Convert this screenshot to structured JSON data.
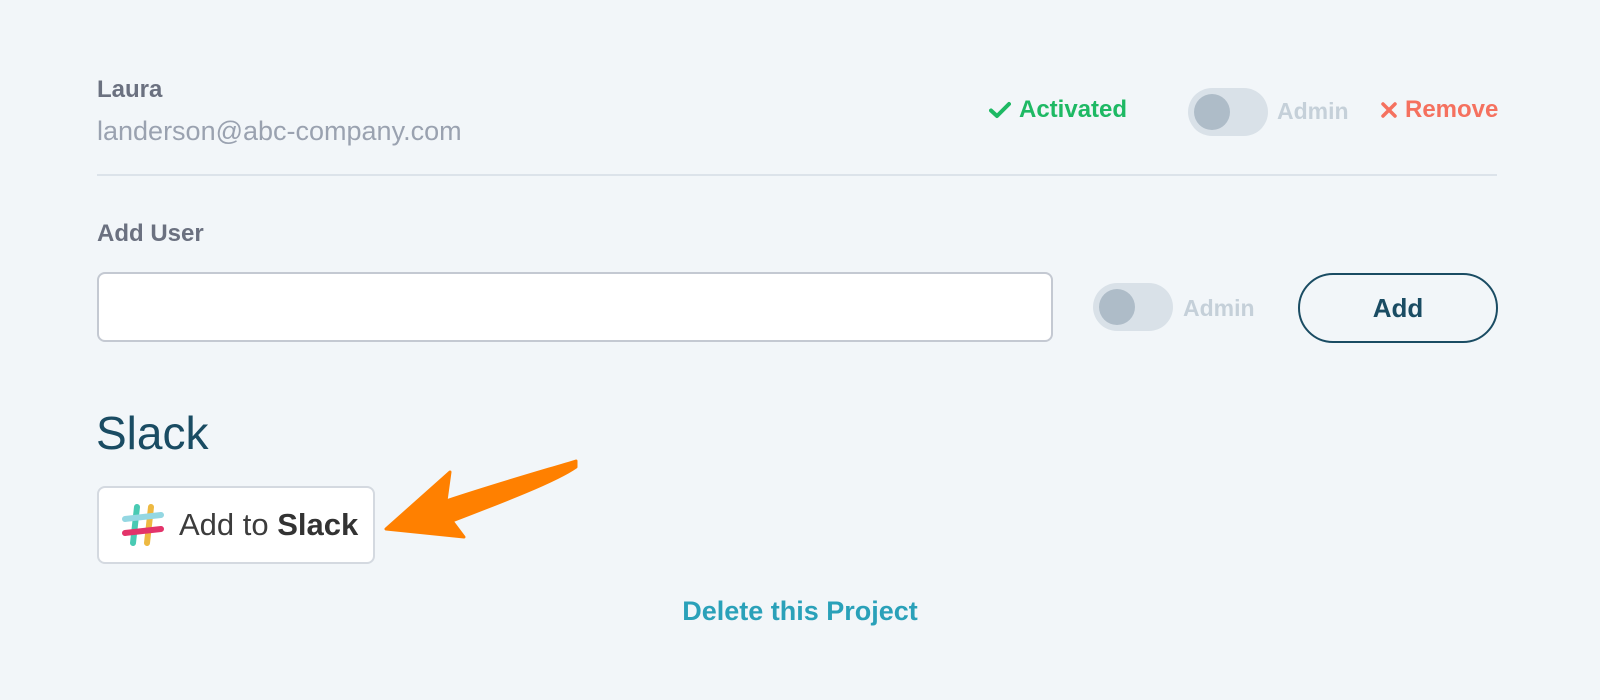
{
  "user": {
    "name": "Laura",
    "email": "landerson@abc-company.com",
    "status_label": "Activated",
    "admin_label": "Admin",
    "remove_label": "Remove"
  },
  "add_user": {
    "heading": "Add User",
    "input_value": "",
    "admin_label": "Admin",
    "add_label": "Add"
  },
  "slack": {
    "heading": "Slack",
    "button_prefix": "Add to ",
    "button_bold": "Slack"
  },
  "delete_label": "Delete this Project",
  "icons": {
    "status": "check-icon",
    "remove": "close-icon",
    "slack": "slack-logo-icon",
    "annotation": "arrow-annotation"
  },
  "colors": {
    "background": "#f2f6f9",
    "success": "#1eb964",
    "danger": "#f5715f",
    "primary": "#1a4c63",
    "link": "#2aa1b9",
    "arrow": "#ff8000"
  }
}
